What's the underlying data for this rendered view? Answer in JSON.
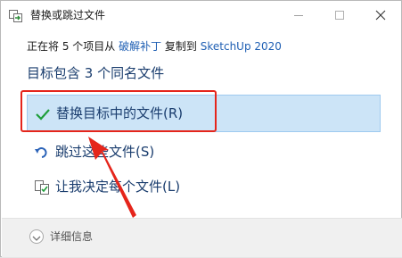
{
  "window": {
    "title": "替换或跳过文件",
    "icon": "file-copy-icon"
  },
  "info": {
    "prefix": "正在将 5 个项目从 ",
    "source": "破解补丁",
    "middle": " 复制到 ",
    "destination": "SketchUp 2020"
  },
  "heading": "目标包含 3 个同名文件",
  "options": [
    {
      "label": "替换目标中的文件(R)",
      "icon": "checkmark-icon",
      "selected": true
    },
    {
      "label": "跳过这些文件(S)",
      "icon": "skip-arrow-icon",
      "selected": false
    },
    {
      "label": "让我决定每个文件(L)",
      "icon": "compare-files-icon",
      "selected": false
    }
  ],
  "footer": {
    "details_label": "详细信息",
    "icon": "chevron-down-icon"
  },
  "annotation": {
    "color": "#e5251b"
  },
  "colors": {
    "accent_text": "#1a3d6e",
    "link": "#1f5fb3",
    "selected_bg": "#cce4f7",
    "checkmark": "#1e9e3a"
  }
}
